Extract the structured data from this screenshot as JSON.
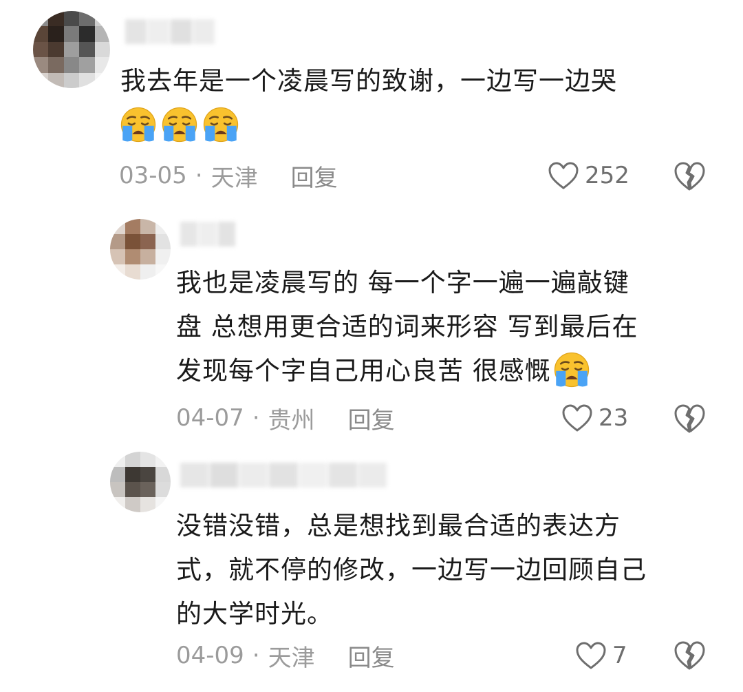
{
  "comments": [
    {
      "text_lines": [
        "我去年是一个凌晨写的致谢，一边写一边哭"
      ],
      "emoji_count": 3,
      "date": "03-05",
      "separator": "·",
      "location": "天津",
      "reply_label": "回复",
      "likes": "252"
    },
    {
      "text_lines": [
        "我也是凌晨写的 每一个字一遍一遍敲键",
        "盘 总想用更合适的词来形容 写到最后在",
        "发现每个字自己用心良苦 很感慨"
      ],
      "emoji_count": 1,
      "date": "04-07",
      "separator": "·",
      "location": "贵州",
      "reply_label": "回复",
      "likes": "23"
    },
    {
      "text_lines": [
        "没错没错，总是想找到最合适的表达方",
        "式，就不停的修改，一边写一边回顾自己",
        "的大学时光。"
      ],
      "emoji_count": 0,
      "date": "04-09",
      "separator": "·",
      "location": "天津",
      "reply_label": "回复",
      "likes": "7"
    }
  ],
  "icons": {
    "like": "heart-outline-icon",
    "dislike": "broken-heart-icon",
    "emoji": "loudly-crying-face-emoji"
  },
  "colors": {
    "text": "#1a1a1a",
    "meta": "#9b9b9b",
    "icon": "#6e6e6e",
    "emoji_face": "#f9c22e",
    "emoji_tears": "#4aa3f5"
  }
}
